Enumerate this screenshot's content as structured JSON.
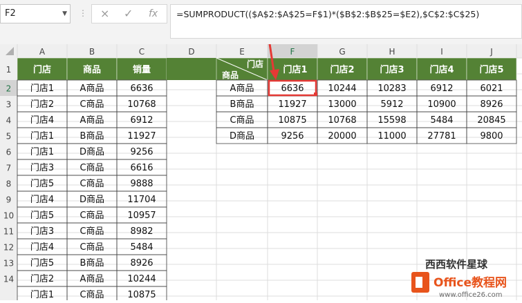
{
  "namebox": {
    "value": "F2"
  },
  "formula_bar": {
    "cancel_icon": "×",
    "enter_icon": "✓",
    "fx_label": "fx",
    "formula": "=SUMPRODUCT(($A$2:$A$25=F$1)*($B$2:$B$25=$E2),$C$2:$C$25)"
  },
  "columns": [
    "A",
    "B",
    "C",
    "D",
    "E",
    "F",
    "G",
    "H",
    "I",
    "J"
  ],
  "rows": [
    "1",
    "2",
    "3",
    "4",
    "5",
    "6",
    "7",
    "8",
    "9",
    "10",
    "11",
    "12",
    "13",
    "14"
  ],
  "left_table": {
    "headers": [
      "门店",
      "商品",
      "销量"
    ],
    "rows": [
      [
        "门店1",
        "A商品",
        "6636"
      ],
      [
        "门店2",
        "C商品",
        "10768"
      ],
      [
        "门店4",
        "A商品",
        "6912"
      ],
      [
        "门店1",
        "B商品",
        "11927"
      ],
      [
        "门店1",
        "D商品",
        "9256"
      ],
      [
        "门店3",
        "C商品",
        "6616"
      ],
      [
        "门店5",
        "C商品",
        "9888"
      ],
      [
        "门店4",
        "D商品",
        "11704"
      ],
      [
        "门店5",
        "C商品",
        "10957"
      ],
      [
        "门店3",
        "C商品",
        "8982"
      ],
      [
        "门店4",
        "C商品",
        "5484"
      ],
      [
        "门店5",
        "B商品",
        "8926"
      ],
      [
        "门店2",
        "A商品",
        "10244"
      ],
      [
        "门店1",
        "C商品",
        "10875"
      ]
    ]
  },
  "pivot": {
    "corner_top": "门店",
    "corner_bottom": "商品",
    "headers": [
      "门店1",
      "门店2",
      "门店3",
      "门店4",
      "门店5"
    ],
    "rows": [
      {
        "label": "A商品",
        "values": [
          "6636",
          "10244",
          "10283",
          "6912",
          "6021"
        ]
      },
      {
        "label": "B商品",
        "values": [
          "11927",
          "13000",
          "5912",
          "10900",
          "8926"
        ]
      },
      {
        "label": "C商品",
        "values": [
          "10875",
          "10768",
          "15598",
          "5484",
          "20845"
        ]
      },
      {
        "label": "D商品",
        "values": [
          "9256",
          "20000",
          "11000",
          "27781",
          "9800"
        ]
      }
    ]
  },
  "watermark": {
    "line1": "西西软件星球",
    "line2": "Office教程网",
    "line3": "www.office26.com"
  },
  "colors": {
    "header_green": "#548235",
    "selection": "#e53935",
    "arrow": "#e53935"
  }
}
